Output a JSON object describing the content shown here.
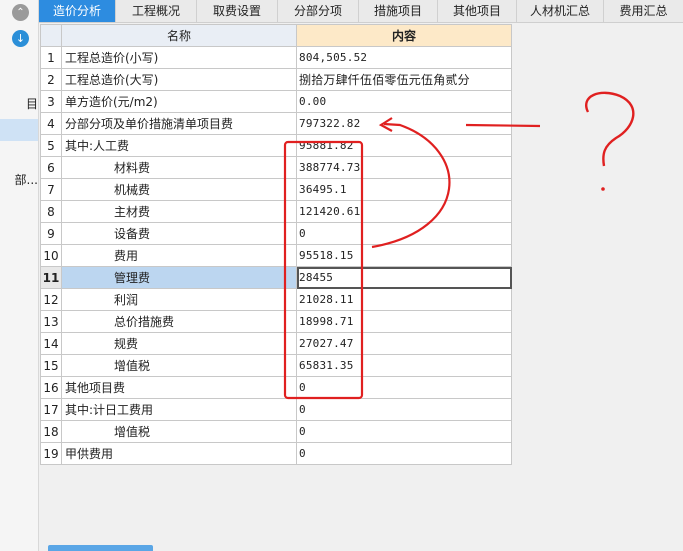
{
  "sidebar": {
    "items": [
      {
        "label": "目"
      },
      {
        "label": ""
      },
      {
        "label": "部..."
      }
    ]
  },
  "tabs": [
    {
      "label": "造价分析"
    },
    {
      "label": "工程概况"
    },
    {
      "label": "取费设置"
    },
    {
      "label": "分部分项"
    },
    {
      "label": "措施项目"
    },
    {
      "label": "其他项目"
    },
    {
      "label": "人材机汇总"
    },
    {
      "label": "费用汇总"
    }
  ],
  "table": {
    "headers": {
      "name": "名称",
      "content": "内容"
    },
    "rows": [
      {
        "idx": "1",
        "name": "工程总造价(小写)",
        "value": "804,505.52"
      },
      {
        "idx": "2",
        "name": "工程总造价(大写)",
        "value": "捌拾万肆仟伍佰零伍元伍角贰分"
      },
      {
        "idx": "3",
        "name": "单方造价(元/m2)",
        "value": "0.00"
      },
      {
        "idx": "4",
        "name": "分部分项及单价措施清单项目费",
        "value": "797322.82"
      },
      {
        "idx": "5",
        "name": "其中:人工费",
        "value": "95881.82"
      },
      {
        "idx": "6",
        "name": "材料费",
        "value": "388774.73"
      },
      {
        "idx": "7",
        "name": "机械费",
        "value": "36495.1"
      },
      {
        "idx": "8",
        "name": "主材费",
        "value": "121420.61"
      },
      {
        "idx": "9",
        "name": "设备费",
        "value": "0"
      },
      {
        "idx": "10",
        "name": "费用",
        "value": "95518.15"
      },
      {
        "idx": "11",
        "name": "管理费",
        "value": "28455"
      },
      {
        "idx": "12",
        "name": "利润",
        "value": "21028.11"
      },
      {
        "idx": "13",
        "name": "总价措施费",
        "value": "18998.71"
      },
      {
        "idx": "14",
        "name": "规费",
        "value": "27027.47"
      },
      {
        "idx": "15",
        "name": "增值税",
        "value": "65831.35"
      },
      {
        "idx": "16",
        "name": "其他项目费",
        "value": "0"
      },
      {
        "idx": "17",
        "name": "其中:计日工费用",
        "value": "0"
      },
      {
        "idx": "18",
        "name": "增值税",
        "value": "0"
      },
      {
        "idx": "19",
        "name": "甲供费用",
        "value": "0"
      }
    ]
  },
  "colors": {
    "active_tab": "#2d8ce0",
    "annotation_red": "#e02020",
    "selected_row": "#bcd6f0"
  }
}
